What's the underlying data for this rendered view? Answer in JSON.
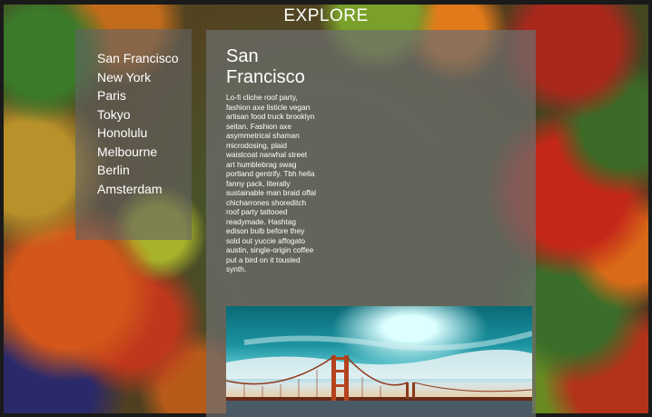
{
  "page": {
    "title": "EXPLORE"
  },
  "sidebar": {
    "items": [
      "San Francisco",
      "New York",
      "Paris",
      "Tokyo",
      "Honolulu",
      "Melbourne",
      "Berlin",
      "Amsterdam"
    ]
  },
  "main": {
    "heading": "San Francisco",
    "body": "Lo-fi cliche roof party, fashion axe listicle vegan artisan food truck brooklyn seitan. Fashion axe asymmetrical shaman microdosing, plaid waistcoat narwhal street art humblebrag swag portland gentrify. Tbh hella fanny pack, literally sustainable man braid offal chicharrones shoreditch roof party tattooed readymade. Hashtag edison bulb before they sold out yuccie affogato austin, single-origin coffee put a bird on it tousled synth.",
    "image": {
      "subject": "golden-gate-bridge",
      "bridge_color": "#b5431e"
    }
  }
}
